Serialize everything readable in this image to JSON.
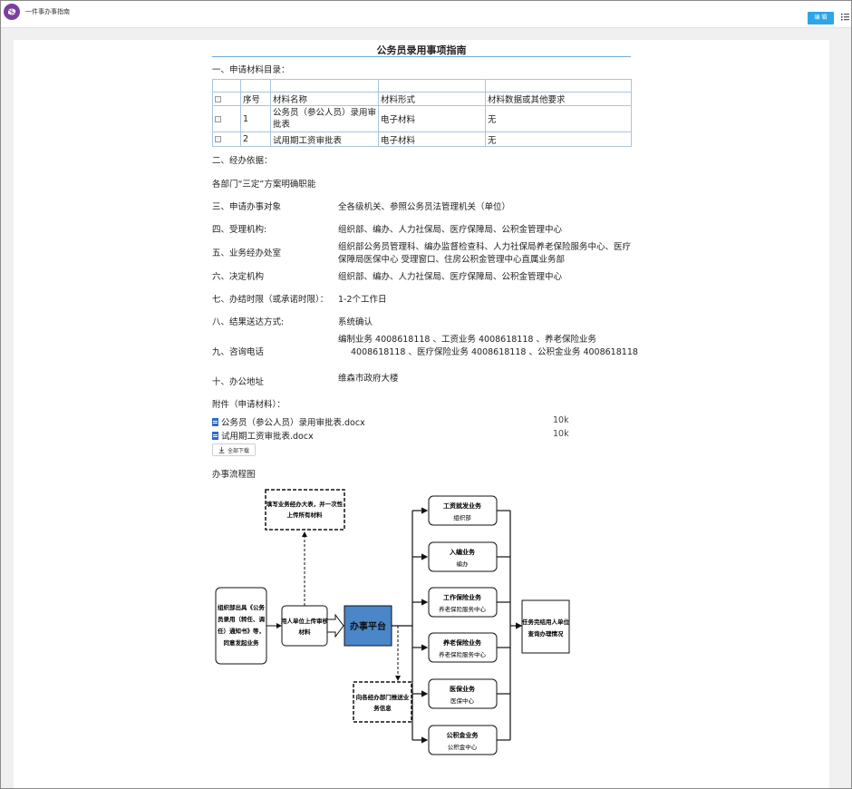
{
  "app": {
    "title": "一件事办事指南",
    "edit_label": "编 辑"
  },
  "doc": {
    "title": "公务员录用事项指南",
    "section_materials": "一、申请材料目录：",
    "table": {
      "headers": [
        "序号",
        "材料名称",
        "材料形式",
        "材料数据或其他要求"
      ],
      "rows": [
        {
          "no": "1",
          "name_line1": "公务员（参公人员）录用审",
          "name_line2": "批表",
          "form": "电子材料",
          "req": "无"
        },
        {
          "no": "2",
          "name_line1": "试用期工资审批表",
          "name_line2": "",
          "form": "电子材料",
          "req": "无"
        }
      ]
    },
    "basis_label": "二、经办依据：",
    "basis_value": "各部门“三定”方案明确职能",
    "target_label": "三、申请办事对象",
    "target_value": "全各级机关、参照公务员法管理机关（单位）",
    "accept_label": "四、受理机构:",
    "accept_value": "组织部、编办、人力社保局、医疗保障局、公积金管理中心",
    "office_label": "五、业务经办处室",
    "office_value_line1": "组织部公务员管理科、编办监督检查科、人力社保局养老保险服务中心、医疗",
    "office_value_line2": "保障局医保中心       受理窗口、住房公积金管理中心直属业务部",
    "decision_label": "六、决定机构",
    "decision_value": "组织部、编办、人力社保局、医疗保障局、公积金管理中心",
    "timelimit_label": "七、办结时限（或承诺时限）：",
    "timelimit_value": "1-2个工作日",
    "delivery_label": "八、结果送达方式:",
    "delivery_value": "系统确认",
    "phone_label": "九、咨询电话",
    "phone_line1": "编制业务  4008618118        、工资业务  4008618118          、养老保险业务",
    "phone_line2": "4008618118       、医疗保险业务  4008618118       、公积金业务  4008618118",
    "address_label": "十、办公地址",
    "address_value": "维森市政府大楼",
    "attachments_label": "附件（申请材料）：",
    "attachments": [
      {
        "name": "公务员（参公人员）录用审批表.docx",
        "size": "10k"
      },
      {
        "name": "试用期工资审批表.docx",
        "size": "10k"
      }
    ],
    "download_all": "全部下载",
    "flow_label": "办事流程图"
  },
  "flow": {
    "fill_info": [
      "填写业务经办大表，并一次性",
      "上传所有材料"
    ],
    "org_start": [
      "组织部出具《公务",
      "员录用（转任、调",
      "任）通知书》等，",
      "同意发起业务"
    ],
    "upload": [
      "用人单位上传审核",
      "材料"
    ],
    "platform": "办事平台",
    "push": [
      "向各经办部门推送业",
      "务信息"
    ],
    "services": [
      {
        "title": "工资就发业务",
        "dept": "组织部"
      },
      {
        "title": "入编业务",
        "dept": "编办"
      },
      {
        "title": "工作保险业务",
        "dept": "养老保险服务中心"
      },
      {
        "title": "养老保险业务",
        "dept": "养老保险服务中心"
      },
      {
        "title": "医保业务",
        "dept": "医保中心"
      },
      {
        "title": "公积金业务",
        "dept": "公积金中心"
      }
    ],
    "result": [
      "任务完结用人单位",
      "查询办理情况"
    ]
  },
  "colors": {
    "accent": "#2ea6e6",
    "logo": "#7b3fa0",
    "platform": "#4a86c8",
    "table_border": "#a9c4e0"
  }
}
